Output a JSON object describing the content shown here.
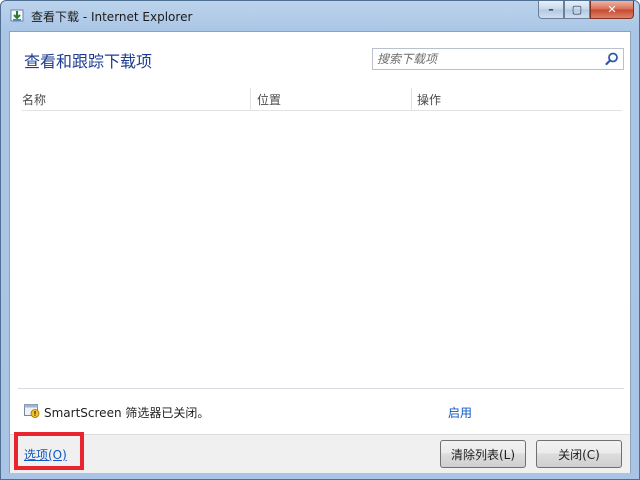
{
  "window": {
    "title": "查看下载 - Internet Explorer",
    "caption": {
      "minimize": "–",
      "maximize": "▢",
      "close": "✕"
    }
  },
  "main": {
    "heading": "查看和跟踪下载项",
    "search": {
      "placeholder": "搜索下载项",
      "value": ""
    },
    "columns": [
      "名称",
      "位置",
      "操作"
    ]
  },
  "smartscreen": {
    "status_text": "SmartScreen 筛选器已关闭。",
    "enable_link": "启用"
  },
  "footer": {
    "options_link": "选项(O)",
    "clear_list_button": "清除列表(L)",
    "close_button": "关闭(C)"
  },
  "colors": {
    "heading": "#1e3d91",
    "link": "#0f57c4",
    "highlight_border": "#e8242c"
  }
}
